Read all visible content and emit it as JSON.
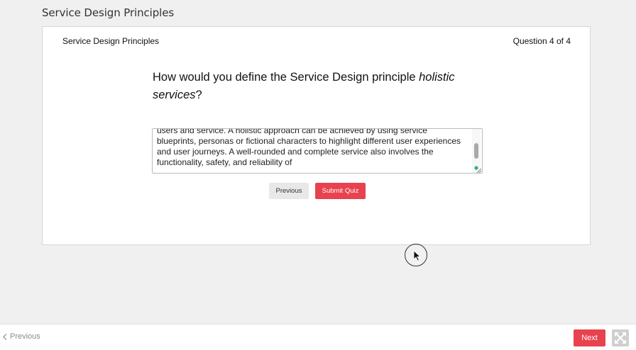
{
  "page": {
    "title": "Service Design Principles"
  },
  "quiz": {
    "name": "Service Design Principles",
    "progress": "Question 4 of 4",
    "question_prefix": "How would you define the Service Design principle ",
    "question_emphasis": "holistic services",
    "question_suffix": "?",
    "answer_text": "users and service. A holistic approach can be achieved by using service blueprints, personas or fictional characters to highlight different user experiences and user journeys. A well-rounded and complete service also involves the functionality, safety, and reliability of",
    "previous_label": "Previous",
    "submit_label": "Submit Quiz"
  },
  "footer": {
    "previous_label": "Previous",
    "next_label": "Next"
  },
  "colors": {
    "accent": "#e8424f",
    "background": "#f0f0f0"
  },
  "icons": {
    "footer_previous": "chevron-left-icon",
    "fullscreen": "expand-icon",
    "cursor": "mouse-pointer-icon",
    "resize": "resize-grip-icon"
  }
}
